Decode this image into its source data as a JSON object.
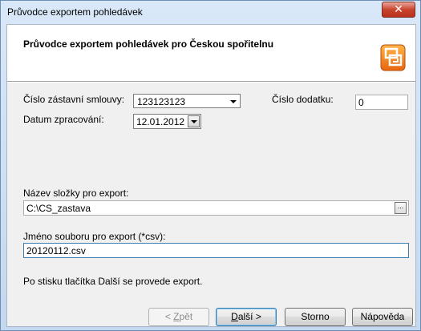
{
  "window": {
    "title": "Průvodce exportem pohledávek",
    "close_glyph": "✕"
  },
  "header": {
    "title": "Průvodce exportem pohledávek pro Českou spořitelnu",
    "logo_icon": "export-wizard-icon"
  },
  "form": {
    "contract_label": "Číslo zástavní smlouvy:",
    "contract_value": "123123123",
    "amendment_label": "Číslo dodatku:",
    "amendment_value": "0",
    "date_label": "Datum zpracování:",
    "date_value": "12.01.2012",
    "folder_label": "Název složky pro export:",
    "folder_value": "C:\\CS_zastava",
    "browse_glyph": "...",
    "file_label": "Jméno souboru pro export (*csv):",
    "file_value": "20120112.csv",
    "info_text": "Po stisku tlačítka Další se provede export."
  },
  "buttons": {
    "back_prefix": "< ",
    "back_accel": "Z",
    "back_rest": "pět",
    "next_accel": "D",
    "next_rest": "alší >",
    "cancel": "Storno",
    "help": "Nápověda"
  },
  "colors": {
    "title_bar": "#c3d8ef",
    "close_button": "#c9442e",
    "focus_border": "#3c7fb1",
    "logo_orange": "#f07a1a"
  }
}
